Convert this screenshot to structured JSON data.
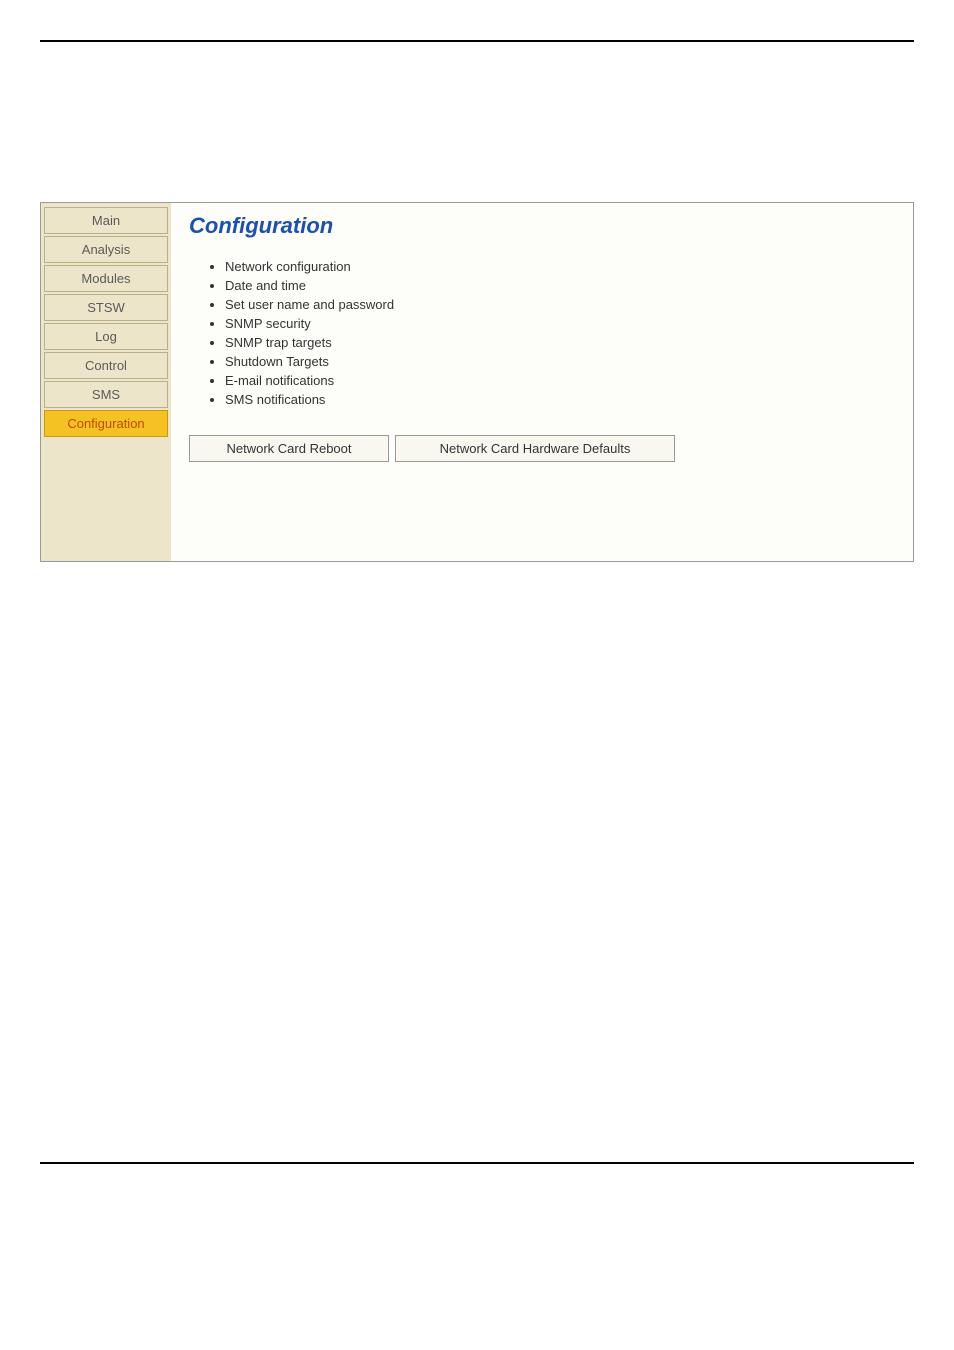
{
  "sidebar": {
    "items": [
      {
        "label": "Main",
        "active": false
      },
      {
        "label": "Analysis",
        "active": false
      },
      {
        "label": "Modules",
        "active": false
      },
      {
        "label": "STSW",
        "active": false
      },
      {
        "label": "Log",
        "active": false
      },
      {
        "label": "Control",
        "active": false
      },
      {
        "label": "SMS",
        "active": false
      },
      {
        "label": "Configuration",
        "active": true
      }
    ]
  },
  "content": {
    "title": "Configuration",
    "links": [
      "Network configuration",
      "Date and time",
      "Set user name and password",
      "SNMP security",
      "SNMP trap targets",
      "Shutdown Targets",
      "E-mail notifications",
      "SMS notifications"
    ],
    "buttons": {
      "reboot": "Network Card Reboot",
      "defaults": "Network Card Hardware Defaults"
    }
  }
}
